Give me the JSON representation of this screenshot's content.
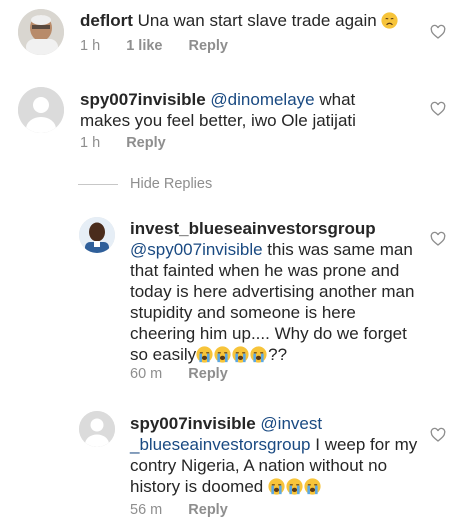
{
  "comments": [
    {
      "username": "deflort",
      "text": "Una wan start slave trade again",
      "emoji_count": 1,
      "emoji": "disappointed-face",
      "time": "1 h",
      "likes": "1 like",
      "reply": "Reply"
    },
    {
      "username": "spy007invisible",
      "mention": "@dinomelaye",
      "text": "what makes you feel better, iwo Ole jatijati",
      "time": "1 h",
      "reply": "Reply"
    }
  ],
  "hide_replies": "Hide Replies",
  "replies": [
    {
      "username": "invest_blueseainvestorsgroup",
      "mention": "@spy007invisible",
      "text": "this was same man that fainted when he was prone and today is here advertising another man stupidity and someone is here cheering him up.... Why do we forget so easily",
      "emoji": "loudly-crying-face",
      "emoji_count": 4,
      "suffix": "??",
      "time": "60 m",
      "reply": "Reply"
    },
    {
      "username": "spy007invisible",
      "mention": "@invest _blueseainvestorsgroup",
      "text": "I weep for my contry Nigeria, A nation without no history is doomed",
      "emoji": "loudly-crying-face",
      "emoji_count": 3,
      "time": "56 m",
      "reply": "Reply"
    }
  ],
  "colors": {
    "text": "#262626",
    "secondary": "#8e8e8e",
    "mention": "#1a4a82",
    "placeholder_avatar": "#dbdbdb"
  },
  "icons": {
    "like": "heart-outline-icon",
    "avatar_placeholder": "default-avatar-icon"
  }
}
